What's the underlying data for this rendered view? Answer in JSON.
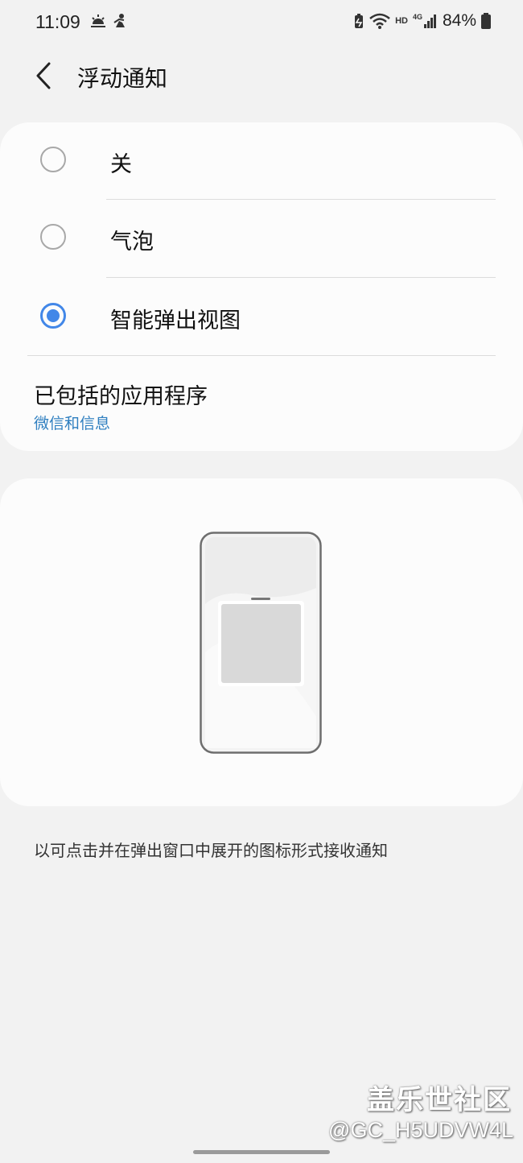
{
  "status_bar": {
    "time": "11:09",
    "battery": "84%",
    "network_label": "HD",
    "network_type": "4G",
    "icons": [
      "sunrise-icon",
      "fitness-icon",
      "battery-saver-icon",
      "wifi-icon",
      "hd-icon",
      "4g-signal-icon",
      "battery-icon"
    ]
  },
  "header": {
    "title": "浮动通知"
  },
  "options": [
    {
      "label": "关",
      "checked": false
    },
    {
      "label": "气泡",
      "checked": false
    },
    {
      "label": "智能弹出视图",
      "checked": true
    }
  ],
  "included_apps": {
    "title": "已包括的应用程序",
    "value": "微信和信息"
  },
  "description": "以可点击并在弹出窗口中展开的图标形式接收通知",
  "watermark": {
    "title": "盖乐世社区",
    "user": "@GC_H5UDVW4L"
  },
  "colors": {
    "accent": "#4287e8",
    "link": "#2f7fc0",
    "background": "#f2f2f2",
    "card": "#fcfcfc"
  }
}
